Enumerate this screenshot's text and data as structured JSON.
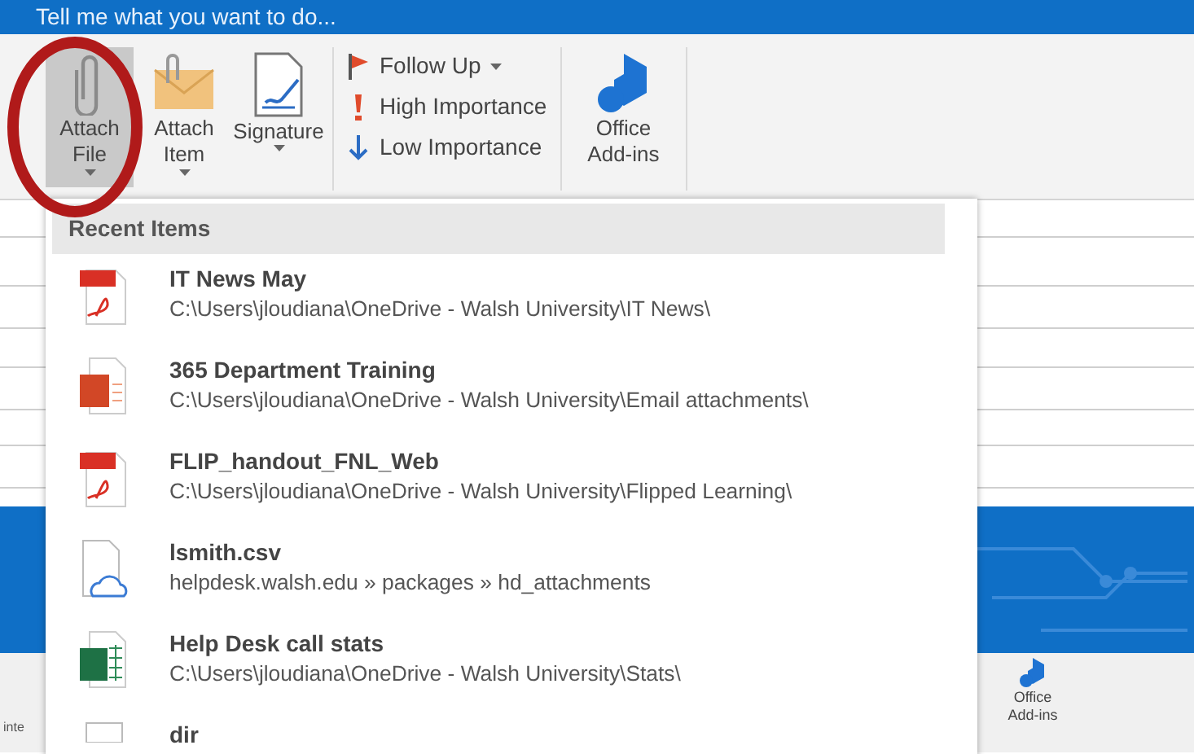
{
  "tell_me": {
    "placeholder": "Tell me what you want to do..."
  },
  "ribbon": {
    "groups": [
      {
        "kind": "large",
        "buttons": [
          {
            "label": "Attach File",
            "has_menu": true,
            "selected": true
          },
          {
            "label": "Attach Item",
            "has_menu": true,
            "selected": false
          },
          {
            "label": "Signature",
            "has_menu": true,
            "selected": false
          }
        ]
      },
      {
        "kind": "small",
        "buttons": [
          {
            "label": "Follow Up",
            "has_menu": true
          },
          {
            "label": "High Importance"
          },
          {
            "label": "Low Importance"
          }
        ]
      },
      {
        "kind": "large",
        "buttons": [
          {
            "label": "Office Add-ins",
            "selected": false
          }
        ]
      }
    ]
  },
  "background": {
    "left_fragment": "inte",
    "addins_label": "Office Add-ins"
  },
  "menu": {
    "header": "Recent Items",
    "items": [
      {
        "kind": "pdf",
        "name": "IT News May",
        "path": "C:\\Users\\jloudiana\\OneDrive - Walsh University\\IT News\\"
      },
      {
        "kind": "pptx",
        "name": "365 Department Training",
        "path": "C:\\Users\\jloudiana\\OneDrive - Walsh University\\Email attachments\\"
      },
      {
        "kind": "pdf",
        "name": "FLIP_handout_FNL_Web",
        "path": "C:\\Users\\jloudiana\\OneDrive - Walsh University\\Flipped Learning\\"
      },
      {
        "kind": "cloud",
        "name": "lsmith.csv",
        "path": "helpdesk.walsh.edu » packages » hd_attachments"
      },
      {
        "kind": "xlsx",
        "name": "Help Desk call stats",
        "path": "C:\\Users\\jloudiana\\OneDrive - Walsh University\\Stats\\"
      },
      {
        "kind": "file",
        "name": "dir"
      }
    ]
  }
}
